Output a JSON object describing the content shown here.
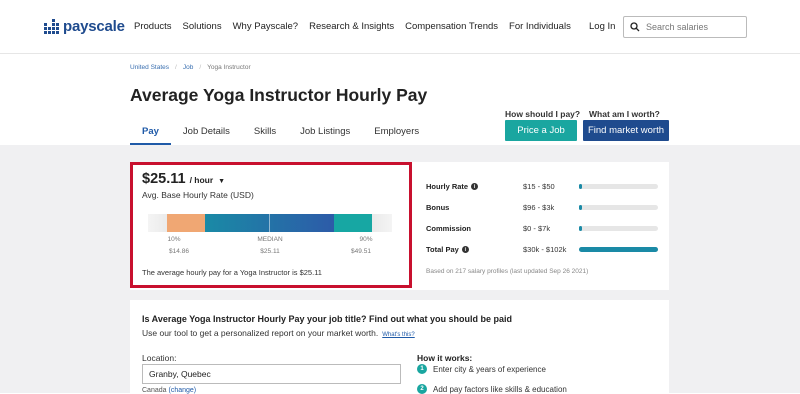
{
  "nav": {
    "brand": "payscale",
    "links": [
      "Products",
      "Solutions",
      "Why Payscale?",
      "Research & Insights",
      "Compensation Trends",
      "For Individuals"
    ],
    "login": "Log In",
    "search_placeholder": "Search salaries"
  },
  "breadcrumb": {
    "items": [
      "United States",
      "Job",
      "Yoga Instructor"
    ]
  },
  "page": {
    "title": "Average Yoga Instructor Hourly Pay"
  },
  "tabs": [
    "Pay",
    "Job Details",
    "Skills",
    "Job Listings",
    "Employers"
  ],
  "cta": {
    "q1": "How should I pay?",
    "q2": "What am I worth?",
    "btn1": "Price a Job",
    "btn2": "Find market worth"
  },
  "pay": {
    "amount": "$25.11",
    "unit": "/ hour",
    "subtitle": "Avg. Base Hourly Rate (USD)",
    "p10_label": "10%",
    "median_label": "MEDIAN",
    "p90_label": "90%",
    "p10_value": "$14.86",
    "median_value": "$25.11",
    "p90_value": "$49.51",
    "summary": "The average hourly pay for a Yoga Instructor is $25.11"
  },
  "stats": [
    {
      "label": "Hourly Rate",
      "info": true,
      "range": "$15 - $50",
      "fill_start": 0.0,
      "fill_end": 0.04
    },
    {
      "label": "Bonus",
      "info": false,
      "range": "$96 - $3k",
      "fill_start": 0.0,
      "fill_end": 0.03
    },
    {
      "label": "Commission",
      "info": false,
      "range": "$0 - $7k",
      "fill_start": 0.0,
      "fill_end": 0.03
    },
    {
      "label": "Total Pay",
      "info": true,
      "range": "$30k - $102k",
      "fill_start": 0.0,
      "fill_end": 1.0
    }
  ],
  "based_on": "Based on 217 salary profiles (last updated Sep 26 2021)",
  "prompt": {
    "title": "Is Average Yoga Instructor Hourly Pay your job title? Find out what you should be paid",
    "subtitle": "Use our tool to get a personalized report on your market worth.",
    "whats_this": "What's this?",
    "location_label": "Location:",
    "location_value": "Granby, Quebec",
    "country": "Canada",
    "change": "(change)",
    "how_title": "How it works:",
    "steps": [
      "Enter city & years of experience",
      "Add pay factors like skills & education"
    ]
  },
  "colors": {
    "brand_blue": "#1f4b8e",
    "teal": "#1aa6a0",
    "highlight_red": "#c8102e"
  }
}
